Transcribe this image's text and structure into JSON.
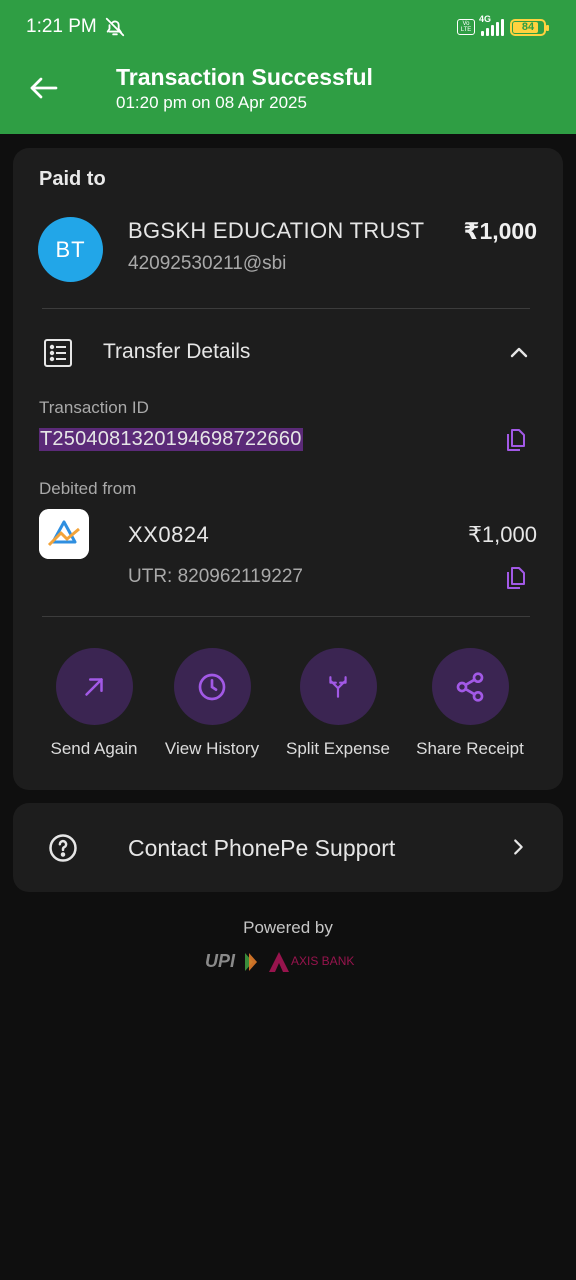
{
  "status_bar": {
    "time": "1:21 PM",
    "volte": "Vo LTE",
    "network": "4G",
    "battery_percent": "84",
    "battery_level": 0.84,
    "accent_color": "#ffd23f"
  },
  "header": {
    "title": "Transaction Successful",
    "subtitle": "01:20 pm on 08 Apr 2025",
    "background_color": "#2f9e44"
  },
  "payment": {
    "paid_to_label": "Paid to",
    "avatar_initials": "BT",
    "payee_name": "BGSKH EDUCATION TRUST",
    "payee_upi": "42092530211@sbi",
    "amount": "₹1,000"
  },
  "transfer_details": {
    "label": "Transfer Details",
    "transaction_id_label": "Transaction ID",
    "transaction_id": "T2504081320194698722660",
    "debited_from_label": "Debited from",
    "account": "XX0824",
    "utr": "UTR: 820962119227",
    "debited_amount": "₹1,000"
  },
  "actions": [
    {
      "label": "Send Again",
      "icon": "arrow-up-right-icon"
    },
    {
      "label": "View History",
      "icon": "clock-icon"
    },
    {
      "label": "Split Expense",
      "icon": "split-icon"
    },
    {
      "label": "Share Receipt",
      "icon": "share-icon"
    }
  ],
  "support": {
    "label": "Contact PhonePe Support"
  },
  "footer": {
    "powered_by": "Powered by",
    "upi_logo_text": "UPI",
    "bank_logo_text": "AXIS BANK"
  },
  "colors": {
    "accent_purple": "#a259e6",
    "icon_circle": "#3b2552"
  }
}
